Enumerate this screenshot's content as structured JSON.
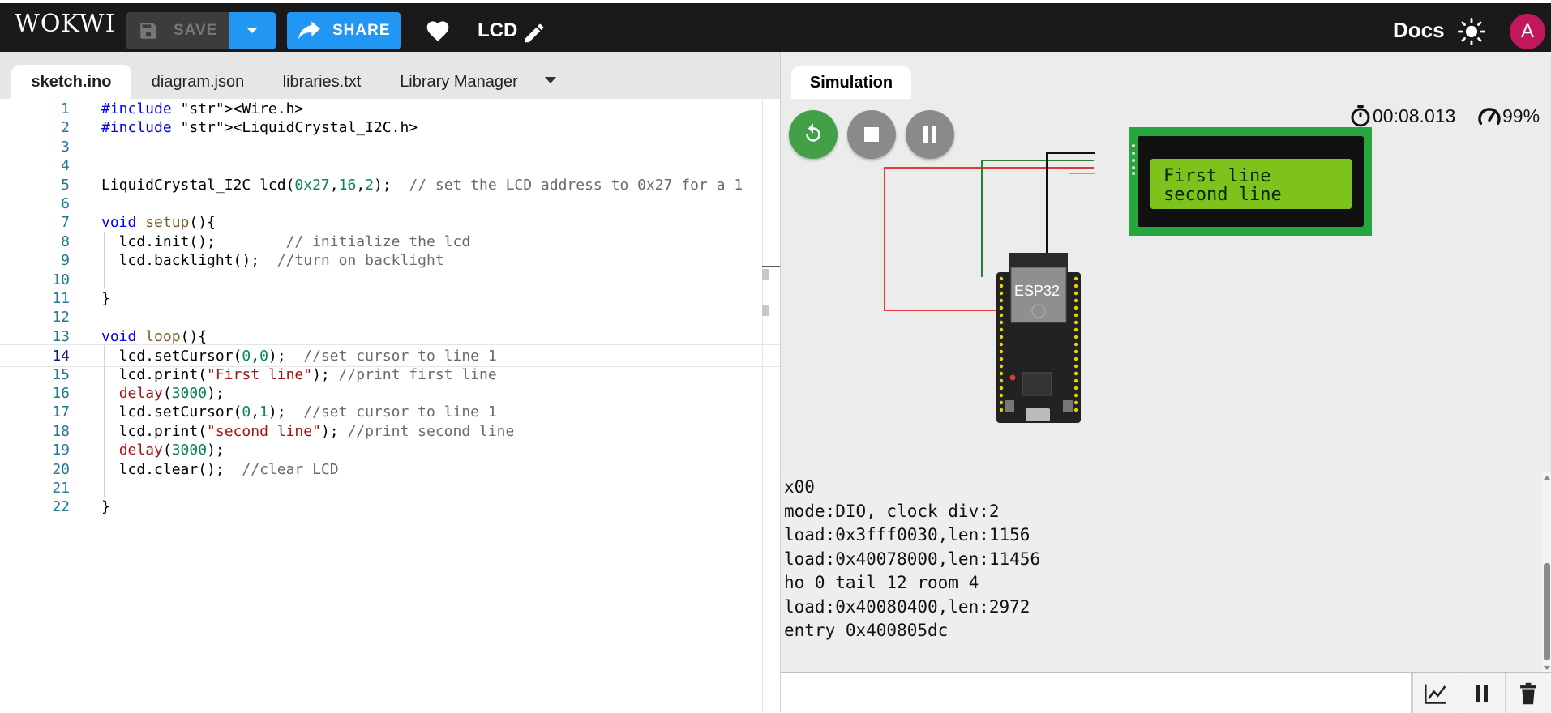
{
  "app": {
    "logo": "WOKWI"
  },
  "toolbar": {
    "save_label": "SAVE",
    "share_label": "SHARE",
    "project_name": "LCD",
    "docs_label": "Docs",
    "avatar_initial": "A",
    "icons": {
      "save": "floppy-disk-icon",
      "dropdown": "caret-down-icon",
      "share": "share-arrow-icon",
      "like": "heart-icon",
      "edit": "pencil-icon",
      "theme": "sun-icon"
    }
  },
  "editor": {
    "tabs": [
      {
        "label": "sketch.ino",
        "active": true
      },
      {
        "label": "diagram.json",
        "active": false
      },
      {
        "label": "libraries.txt",
        "active": false
      },
      {
        "label": "Library Manager",
        "active": false
      }
    ],
    "current_line": 14,
    "lines": [
      {
        "n": "1",
        "text": "#include <Wire.h>"
      },
      {
        "n": "2",
        "text": "#include <LiquidCrystal_I2C.h>"
      },
      {
        "n": "3",
        "text": ""
      },
      {
        "n": "4",
        "text": ""
      },
      {
        "n": "5",
        "text": "LiquidCrystal_I2C lcd(0x27,16,2);  // set the LCD address to 0x27 for a 1"
      },
      {
        "n": "6",
        "text": ""
      },
      {
        "n": "7",
        "text": "void setup(){"
      },
      {
        "n": "8",
        "text": "  lcd.init();        // initialize the lcd"
      },
      {
        "n": "9",
        "text": "  lcd.backlight();  //turn on backlight"
      },
      {
        "n": "10",
        "text": ""
      },
      {
        "n": "11",
        "text": "}"
      },
      {
        "n": "12",
        "text": ""
      },
      {
        "n": "13",
        "text": "void loop(){"
      },
      {
        "n": "14",
        "text": "  lcd.setCursor(0,0);  //set cursor to line 1"
      },
      {
        "n": "15",
        "text": "  lcd.print(\"First line\"); //print first line"
      },
      {
        "n": "16",
        "text": "  delay(3000);"
      },
      {
        "n": "17",
        "text": "  lcd.setCursor(0,1);  //set cursor to line 1"
      },
      {
        "n": "18",
        "text": "  lcd.print(\"second line\"); //print second line"
      },
      {
        "n": "19",
        "text": "  delay(3000);"
      },
      {
        "n": "20",
        "text": "  lcd.clear();  //clear LCD"
      },
      {
        "n": "21",
        "text": ""
      },
      {
        "n": "22",
        "text": "}"
      }
    ]
  },
  "simulation": {
    "tab_label": "Simulation",
    "timer": "00:08.013",
    "speed": "99%",
    "controls": {
      "restart": "restart-icon",
      "stop": "stop-icon",
      "pause": "pause-icon"
    },
    "board_label": "ESP32",
    "lcd_line1": "First line",
    "lcd_line2": "second line",
    "colors": {
      "lcd_frame": "#27a640",
      "lcd_screen": "#7ec31b",
      "restart": "#43a047",
      "wire_red": "#e53935",
      "wire_green": "#2e7d32",
      "wire_black": "#111111",
      "wire_pink": "#e07bd0"
    }
  },
  "serial": {
    "lines": [
      "x00",
      "mode:DIO, clock div:2",
      "load:0x3fff0030,len:1156",
      "load:0x40078000,len:11456",
      "ho 0 tail 12 room 4",
      "load:0x40080400,len:2972",
      "entry 0x400805dc"
    ],
    "input_value": "",
    "buttons": {
      "plotter": "chart-line-icon",
      "pause": "pause-icon",
      "clear": "trash-icon"
    }
  }
}
